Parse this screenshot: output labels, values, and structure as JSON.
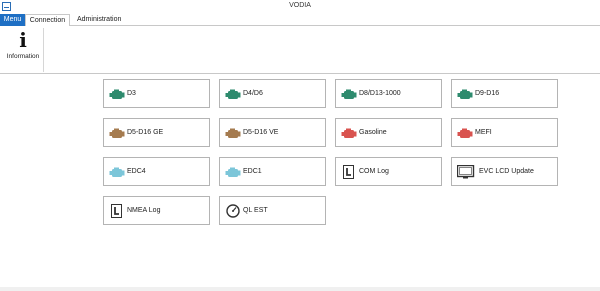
{
  "window": {
    "title": "VODIA"
  },
  "tabs": {
    "menu": "Menu",
    "connection": "Connection",
    "administration": "Administration"
  },
  "ribbon": {
    "information_label": "Information",
    "information_glyph": "i"
  },
  "tiles": [
    {
      "label": "D3",
      "icon": "engine-icon",
      "color": "#2e8b6e"
    },
    {
      "label": "D4/D6",
      "icon": "engine-icon",
      "color": "#2e8b6e"
    },
    {
      "label": "D8/D13-1000",
      "icon": "engine-icon",
      "color": "#2e8b6e"
    },
    {
      "label": "D9-D16",
      "icon": "engine-icon",
      "color": "#2e8b6e"
    },
    {
      "label": "D5-D16 GE",
      "icon": "engine-icon",
      "color": "#a57b4f"
    },
    {
      "label": "D5-D16 VE",
      "icon": "engine-icon",
      "color": "#a57b4f"
    },
    {
      "label": "Gasoline",
      "icon": "engine-icon",
      "color": "#d9534f"
    },
    {
      "label": "MEFI",
      "icon": "engine-icon",
      "color": "#d9534f"
    },
    {
      "label": "EDC4",
      "icon": "engine-icon",
      "color": "#7cc6d9"
    },
    {
      "label": "EDC1",
      "icon": "engine-icon",
      "color": "#7cc6d9"
    },
    {
      "label": "COM Log",
      "icon": "log-icon",
      "color": "#333333"
    },
    {
      "label": "EVC LCD Update",
      "icon": "monitor-icon",
      "color": "#333333"
    },
    {
      "label": "NMEA Log",
      "icon": "log-icon",
      "color": "#333333"
    },
    {
      "label": "QL EST",
      "icon": "gauge-icon",
      "color": "#333333"
    }
  ]
}
